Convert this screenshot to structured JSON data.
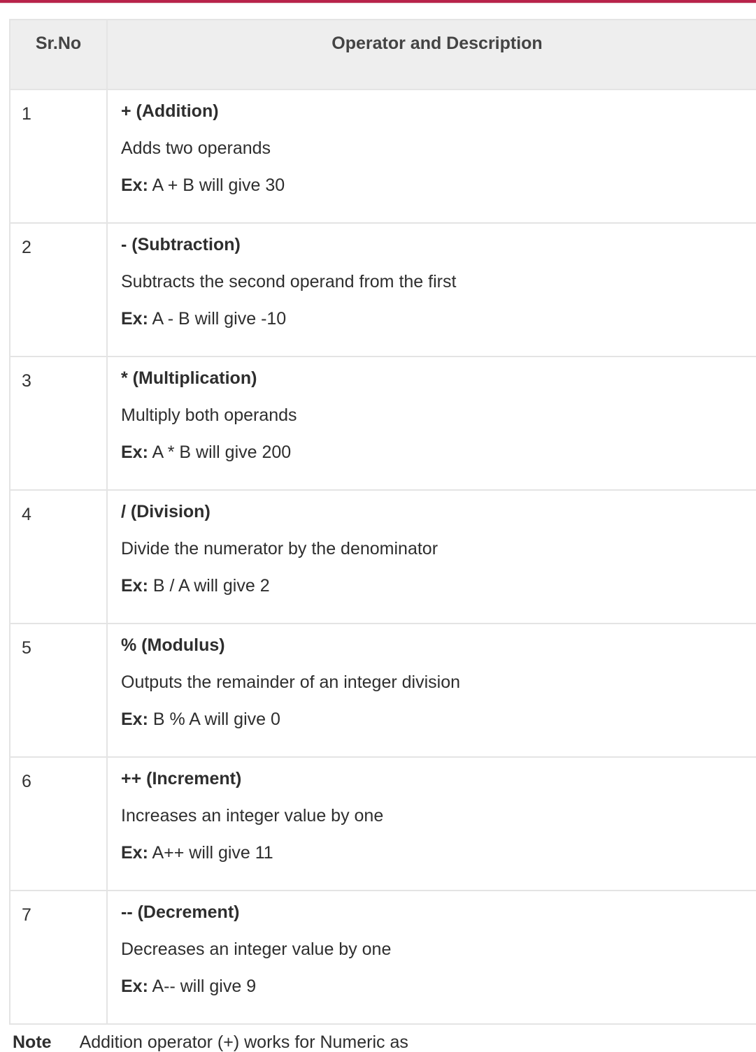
{
  "table": {
    "headers": {
      "col1": "Sr.No",
      "col2": "Operator and Description"
    },
    "rows": [
      {
        "num": "1",
        "name": "+ (Addition)",
        "description": "Adds two operands",
        "ex_label": "Ex:",
        "example": " A + B will give 30"
      },
      {
        "num": "2",
        "name": "- (Subtraction)",
        "description": "Subtracts the second operand from the first",
        "ex_label": "Ex:",
        "example": " A - B will give -10"
      },
      {
        "num": "3",
        "name": "* (Multiplication)",
        "description": "Multiply both operands",
        "ex_label": "Ex:",
        "example": " A * B will give 200"
      },
      {
        "num": "4",
        "name": "/ (Division)",
        "description": "Divide the numerator by the denominator",
        "ex_label": "Ex:",
        "example": " B / A will give 2"
      },
      {
        "num": "5",
        "name": "% (Modulus)",
        "description": "Outputs the remainder of an integer division",
        "ex_label": "Ex:",
        "example": " B % A will give 0"
      },
      {
        "num": "6",
        "name": "++ (Increment)",
        "description": "Increases an integer value by one",
        "ex_label": "Ex:",
        "example": " A++ will give 11"
      },
      {
        "num": "7",
        "name": "-- (Decrement)",
        "description": "Decreases an integer value by one",
        "ex_label": "Ex:",
        "example": " A-- will give 9"
      }
    ]
  },
  "note": {
    "label": "Note",
    "text": "Addition operator (+) works for Numeric as"
  },
  "colors": {
    "accent_bar": "#b8234a",
    "header_bg": "#eeeeee",
    "border": "#e4e4e4"
  }
}
